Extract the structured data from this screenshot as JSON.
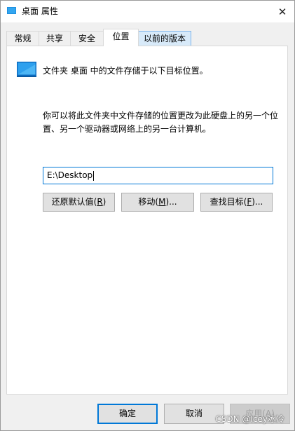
{
  "window": {
    "title": "桌面 属性",
    "close_symbol": "✕"
  },
  "tabs": [
    {
      "label": "常规"
    },
    {
      "label": "共享"
    },
    {
      "label": "安全"
    },
    {
      "label": "位置"
    },
    {
      "label": "以前的版本"
    }
  ],
  "location": {
    "header": "文件夹 桌面 中的文件存储于以下目标位置。",
    "description": "你可以将此文件夹中文件存储的位置更改为此硬盘上的另一个位置、另一个驱动器或网络上的另一台计算机。",
    "path_value": "E:\\Desktop",
    "restore_label": "还原默认值(",
    "restore_key": "R",
    "restore_suffix": ")",
    "move_label": "移动(",
    "move_key": "M",
    "move_suffix": ")...",
    "find_label": "查找目标(",
    "find_key": "F",
    "find_suffix": ")..."
  },
  "footer": {
    "ok_label": "确定",
    "cancel_label": "取消",
    "apply_label": "应用(",
    "apply_key": "A",
    "apply_suffix": ")"
  },
  "watermark": "CSDN @Icey冰冷",
  "colors": {
    "accent": "#0078d7",
    "panel": "#ffffff",
    "chrome": "#f0f0f0"
  },
  "icons": {
    "title": "folder-desktop-icon",
    "header": "desktop-monitor-icon",
    "close": "close-icon"
  }
}
